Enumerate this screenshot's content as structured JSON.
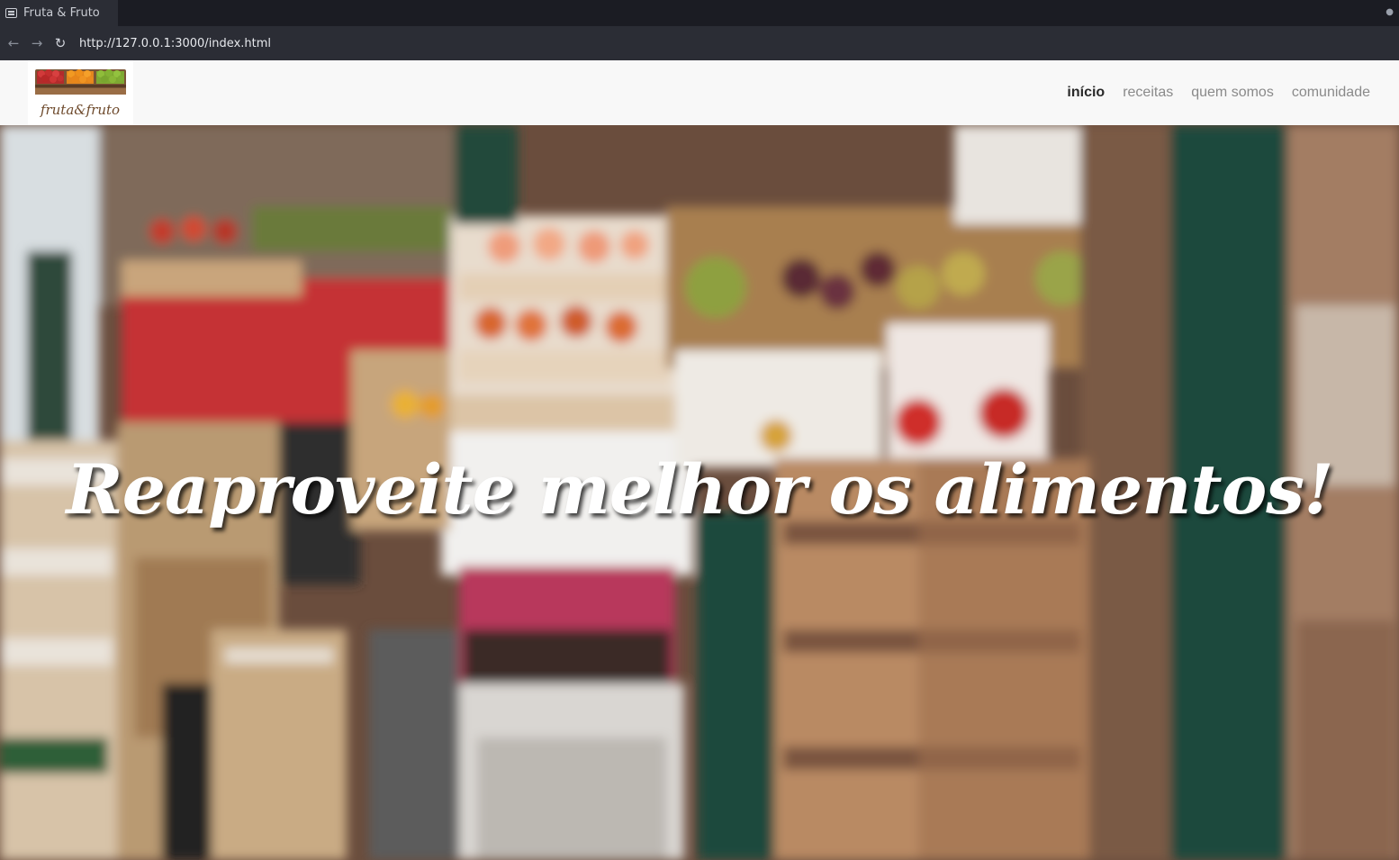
{
  "browser": {
    "tab_title": "Fruta & Fruto",
    "url": "http://127.0.0.1:3000/index.html"
  },
  "site": {
    "logo_text": "fruta&fruto",
    "nav": [
      {
        "label": "início",
        "active": true
      },
      {
        "label": "receitas",
        "active": false
      },
      {
        "label": "quem somos",
        "active": false
      },
      {
        "label": "comunidade",
        "active": false
      }
    ]
  },
  "hero": {
    "title": "Reaproveite melhor os alimentos!",
    "background_description": "blurred market stalls with fruit crates"
  },
  "colors": {
    "nav_bg": "#f8f8f8",
    "nav_active": "#2a2a2a",
    "nav_inactive": "#8a8a8a",
    "hero_text": "#ffffff"
  }
}
